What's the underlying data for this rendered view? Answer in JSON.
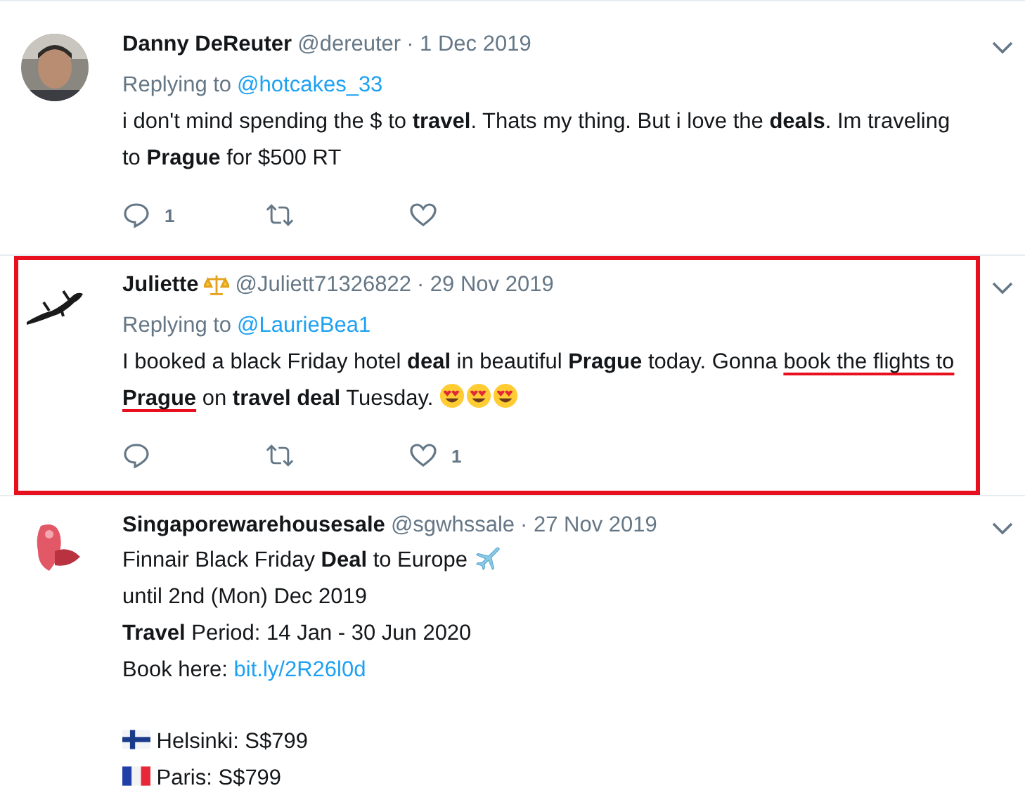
{
  "tweets": [
    {
      "name": "Danny DeReuter",
      "badge": false,
      "handle": "@dereuter",
      "date": "· 1 Dec 2019",
      "replying_label": "Replying to",
      "replying_to": "@hotcakes_33",
      "highlighted": false,
      "avatar": {
        "kind": "picture"
      },
      "body": [
        {
          "space_before": false,
          "segments": [
            {
              "kind": "text",
              "underlined": false,
              "text": "i don't mind spending the $ to **travel**. Thats my thing. But i love the **deals**. Im traveling to **Prague** for $500 RT"
            }
          ]
        }
      ],
      "actions": {
        "replies": "1"
      }
    },
    {
      "name": "Juliette",
      "badge": true,
      "handle": "@Juliett71326822",
      "date": "· 29 Nov 2019",
      "replying_label": "Replying to",
      "replying_to": "@LaurieBea1",
      "highlighted": true,
      "avatar": {
        "kind": "picture"
      },
      "body": [
        {
          "space_before": false,
          "segments": [
            {
              "kind": "text",
              "underlined": false,
              "text": "I booked a black Friday hotel **deal** in beautiful **Prague** today. Gonna "
            },
            {
              "kind": "text",
              "underlined": true,
              "text": "book the flights to **Prague**"
            },
            {
              "kind": "text",
              "underlined": false,
              "text": " on **travel deal** Tuesday. "
            },
            {
              "kind": "smiley"
            },
            {
              "kind": "smiley"
            },
            {
              "kind": "smiley"
            }
          ]
        }
      ],
      "actions": {
        "likes": "1"
      }
    },
    {
      "name": "Singaporewarehousesale",
      "badge": false,
      "handle": "@sgwhssale",
      "date": "· 27 Nov 2019",
      "highlighted": false,
      "avatar": {
        "kind": "picture"
      },
      "body": [
        {
          "space_before": false,
          "segments": [
            {
              "kind": "text",
              "underlined": false,
              "text": "Finnair Black Friday **Deal** to Europe "
            },
            {
              "kind": "plane"
            }
          ]
        },
        {
          "space_before": false,
          "segments": [
            {
              "kind": "text",
              "underlined": false,
              "text": "until 2nd (Mon) Dec 2019"
            }
          ]
        },
        {
          "space_before": false,
          "segments": [
            {
              "kind": "text",
              "underlined": false,
              "text": "**Travel** Period: 14 Jan - 30 Jun 2020"
            }
          ]
        },
        {
          "space_before": false,
          "segments": [
            {
              "kind": "text",
              "underlined": false,
              "text": "Book here: "
            },
            {
              "kind": "link",
              "text": "bit.ly/2R26l0d"
            }
          ]
        },
        {
          "space_before": true,
          "segments": [
            {
              "kind": "finland"
            },
            {
              "kind": "text",
              "underlined": false,
              "text": " Helsinki: S$799"
            }
          ]
        },
        {
          "space_before": false,
          "segments": [
            {
              "kind": "france"
            },
            {
              "kind": "text",
              "underlined": false,
              "text": " Paris: S$799"
            }
          ]
        }
      ]
    }
  ]
}
